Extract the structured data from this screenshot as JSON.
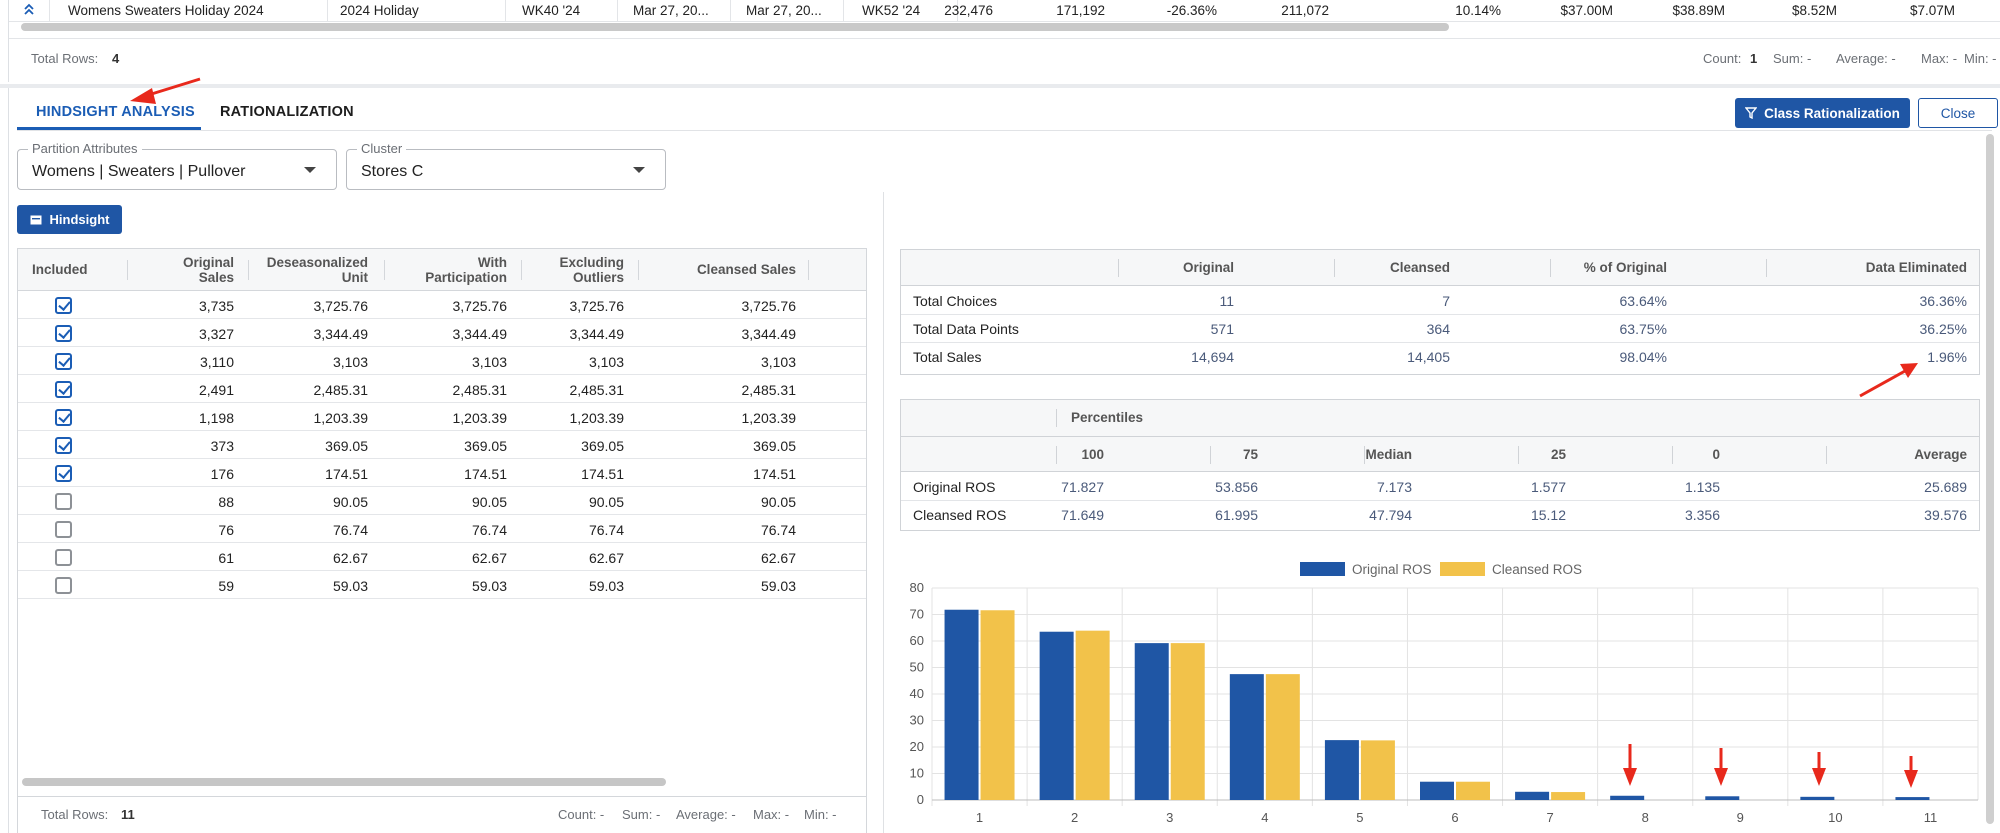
{
  "top_grid": {
    "row": {
      "name": "Womens Sweaters Holiday 2024",
      "season": "2024 Holiday",
      "start_week": "WK40 '24",
      "date1": "Mar 27, 20...",
      "date2": "Mar 27, 20...",
      "end_week": "WK52 '24",
      "v1": "232,476",
      "v2": "171,192",
      "v3": "-26.36%",
      "v4": "211,072",
      "v5": "10.14%",
      "v6": "$37.00M",
      "v7": "$38.89M",
      "v8": "$8.52M",
      "v9": "$7.07M"
    },
    "footer": {
      "total_rows_label": "Total Rows:",
      "total_rows_value": "4",
      "count_label": "Count:",
      "count_value": "1",
      "sum": "Sum: -",
      "average": "Average: -",
      "max": "Max: -",
      "min": "Min: -"
    }
  },
  "tabs": {
    "hindsight": "HINDSIGHT ANALYSIS",
    "rationalization": "RATIONALIZATION"
  },
  "actions": {
    "class_rationalization": "Class Rationalization",
    "close": "Close",
    "hindsight": "Hindsight"
  },
  "filters": {
    "partition": {
      "legend": "Partition Attributes",
      "value": "Womens | Sweaters | Pullover"
    },
    "cluster": {
      "legend": "Cluster",
      "value": "Stores C"
    }
  },
  "left_table": {
    "headers": {
      "included": "Included",
      "original_1": "Original",
      "original_2": "Sales",
      "deseason_1": "Deseasonalized",
      "deseason_2": "Unit",
      "with_1": "With",
      "with_2": "Participation",
      "excl_1": "Excluding",
      "excl_2": "Outliers",
      "cleansed": "Cleansed Sales"
    },
    "rows": [
      {
        "included": true,
        "original": "3,735",
        "deseason": "3,725.76",
        "with": "3,725.76",
        "excl": "3,725.76",
        "cleansed": "3,725.76"
      },
      {
        "included": true,
        "original": "3,327",
        "deseason": "3,344.49",
        "with": "3,344.49",
        "excl": "3,344.49",
        "cleansed": "3,344.49"
      },
      {
        "included": true,
        "original": "3,110",
        "deseason": "3,103",
        "with": "3,103",
        "excl": "3,103",
        "cleansed": "3,103"
      },
      {
        "included": true,
        "original": "2,491",
        "deseason": "2,485.31",
        "with": "2,485.31",
        "excl": "2,485.31",
        "cleansed": "2,485.31"
      },
      {
        "included": true,
        "original": "1,198",
        "deseason": "1,203.39",
        "with": "1,203.39",
        "excl": "1,203.39",
        "cleansed": "1,203.39"
      },
      {
        "included": true,
        "original": "373",
        "deseason": "369.05",
        "with": "369.05",
        "excl": "369.05",
        "cleansed": "369.05"
      },
      {
        "included": true,
        "original": "176",
        "deseason": "174.51",
        "with": "174.51",
        "excl": "174.51",
        "cleansed": "174.51"
      },
      {
        "included": false,
        "original": "88",
        "deseason": "90.05",
        "with": "90.05",
        "excl": "90.05",
        "cleansed": "90.05"
      },
      {
        "included": false,
        "original": "76",
        "deseason": "76.74",
        "with": "76.74",
        "excl": "76.74",
        "cleansed": "76.74"
      },
      {
        "included": false,
        "original": "61",
        "deseason": "62.67",
        "with": "62.67",
        "excl": "62.67",
        "cleansed": "62.67"
      },
      {
        "included": false,
        "original": "59",
        "deseason": "59.03",
        "with": "59.03",
        "excl": "59.03",
        "cleansed": "59.03"
      }
    ],
    "footer": {
      "total_rows_label": "Total Rows:",
      "total_rows_value": "11",
      "count": "Count: -",
      "sum": "Sum: -",
      "average": "Average: -",
      "max": "Max: -",
      "min": "Min: -"
    }
  },
  "summary_table": {
    "headers": {
      "original": "Original",
      "cleansed": "Cleansed",
      "pct": "% of Original",
      "eliminated": "Data Eliminated"
    },
    "rows": [
      {
        "label": "Total Choices",
        "original": "11",
        "cleansed": "7",
        "pct": "63.64%",
        "eliminated": "36.36%"
      },
      {
        "label": "Total Data Points",
        "original": "571",
        "cleansed": "364",
        "pct": "63.75%",
        "eliminated": "36.25%"
      },
      {
        "label": "Total Sales",
        "original": "14,694",
        "cleansed": "14,405",
        "pct": "98.04%",
        "eliminated": "1.96%"
      }
    ]
  },
  "percentile_table": {
    "group_header": "Percentiles",
    "headers": {
      "p100": "100",
      "p75": "75",
      "median": "Median",
      "p25": "25",
      "p0": "0",
      "avg": "Average"
    },
    "rows": [
      {
        "label": "Original ROS",
        "p100": "71.827",
        "p75": "53.856",
        "median": "7.173",
        "p25": "1.577",
        "p0": "1.135",
        "avg": "25.689"
      },
      {
        "label": "Cleansed ROS",
        "p100": "71.649",
        "p75": "61.995",
        "median": "47.794",
        "p25": "15.12",
        "p0": "3.356",
        "avg": "39.576"
      }
    ]
  },
  "chart_data": {
    "type": "bar",
    "categories": [
      "1",
      "2",
      "3",
      "4",
      "5",
      "6",
      "7",
      "8",
      "9",
      "10",
      "11"
    ],
    "series": [
      {
        "name": "Original ROS",
        "color": "#1f56a5",
        "values": [
          71.8,
          63.5,
          59.2,
          47.5,
          22.6,
          6.9,
          3.1,
          1.6,
          1.4,
          1.2,
          1.1
        ]
      },
      {
        "name": "Cleansed ROS",
        "color": "#f2c24a",
        "values": [
          71.6,
          63.9,
          59.2,
          47.5,
          22.5,
          6.9,
          3.0,
          0,
          0,
          0,
          0
        ]
      }
    ],
    "ylim": [
      0,
      80
    ],
    "yticks": [
      "0",
      "10",
      "20",
      "30",
      "40",
      "50",
      "60",
      "70",
      "80"
    ],
    "grid": true,
    "legend_position": "top-center"
  }
}
